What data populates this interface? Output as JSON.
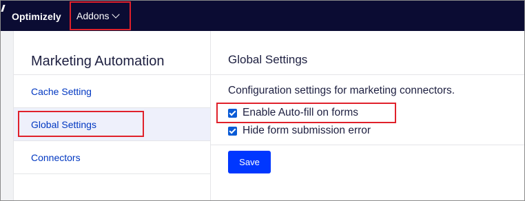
{
  "topbar": {
    "brand": "Optimizely",
    "addons_label": "Addons"
  },
  "sidebar": {
    "title": "Marketing Automation",
    "items": [
      {
        "label": "Cache Setting",
        "active": false
      },
      {
        "label": "Global Settings",
        "active": true
      },
      {
        "label": "Connectors",
        "active": false
      }
    ]
  },
  "main": {
    "title": "Global Settings",
    "description": "Configuration settings for marketing connectors.",
    "checkboxes": [
      {
        "label": "Enable Auto-fill on forms",
        "checked": true
      },
      {
        "label": "Hide form submission error",
        "checked": true
      }
    ],
    "save_label": "Save"
  },
  "colors": {
    "nav_bg": "#0b0c33",
    "link": "#0037c1",
    "primary_button": "#0037ff",
    "highlight": "#e0202a",
    "active_item_bg": "#eef0fb"
  },
  "icons": {
    "addons_dropdown": "chevron-down-icon",
    "checkbox": "checkmark-icon"
  }
}
